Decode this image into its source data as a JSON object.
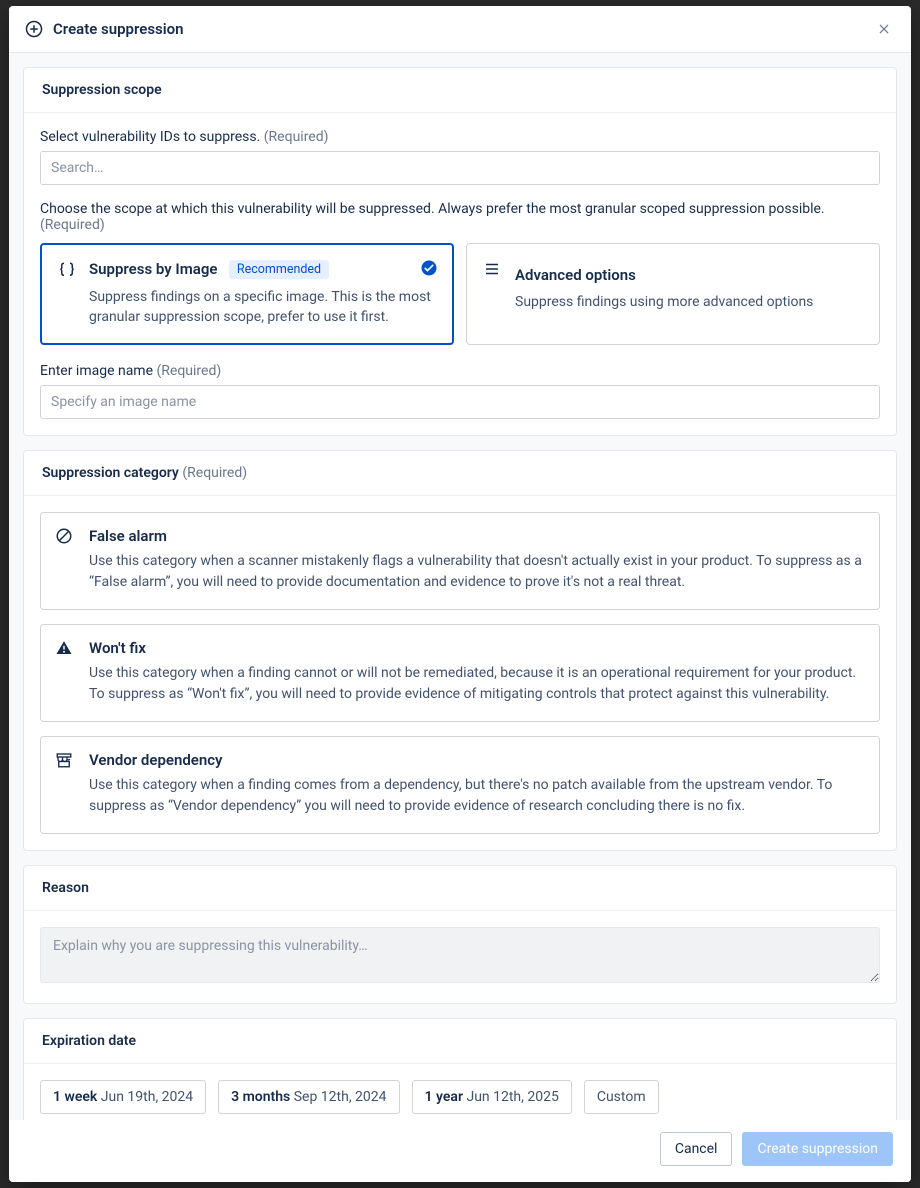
{
  "dialog": {
    "title": "Create suppression"
  },
  "scope": {
    "heading": "Suppression scope",
    "select_label": "Select vulnerability IDs to suppress.",
    "select_required": "(Required)",
    "search_placeholder": "Search…",
    "choose_text": "Choose the scope at which this vulnerability will be suppressed. Always prefer the most granular scoped suppression possible.",
    "choose_required": "(Required)",
    "by_image": {
      "title": "Suppress by Image",
      "badge": "Recommended",
      "desc": "Suppress findings on a specific image. This is the most granular suppression scope, prefer to use it first."
    },
    "advanced": {
      "title": "Advanced options",
      "desc": "Suppress findings using more advanced options"
    },
    "image_label": "Enter image name",
    "image_required": "(Required)",
    "image_placeholder": "Specify an image name"
  },
  "category": {
    "heading": "Suppression category",
    "heading_required": "(Required)",
    "false_alarm": {
      "title": "False alarm",
      "desc": "Use this category when a scanner mistakenly flags a vulnerability that doesn't actually exist in your product. To suppress as a “False alarm”, you will need to provide documentation and evidence to prove it's not a real threat."
    },
    "wont_fix": {
      "title": "Won't fix",
      "desc": "Use this category when a finding cannot or will not be remediated, because it is an operational requirement for your product. To suppress as “Won't fix”, you will need to provide evidence of mitigating controls that protect against this vulnerability."
    },
    "vendor_dep": {
      "title": "Vendor dependency",
      "desc": "Use this category when a finding comes from a dependency, but there's no patch available from the upstream vendor. To suppress as “Vendor dependency” you will need to provide evidence of research concluding there is no fix."
    }
  },
  "reason": {
    "heading": "Reason",
    "placeholder": "Explain why you are suppressing this vulnerability…"
  },
  "expiration": {
    "heading": "Expiration date",
    "options": [
      {
        "label": "1 week",
        "date": "Jun 19th, 2024"
      },
      {
        "label": "3 months",
        "date": "Sep 12th, 2024"
      },
      {
        "label": "1 year",
        "date": "Jun 12th, 2025"
      },
      {
        "label": "Custom",
        "date": ""
      }
    ]
  },
  "footer": {
    "cancel": "Cancel",
    "submit": "Create suppression"
  }
}
